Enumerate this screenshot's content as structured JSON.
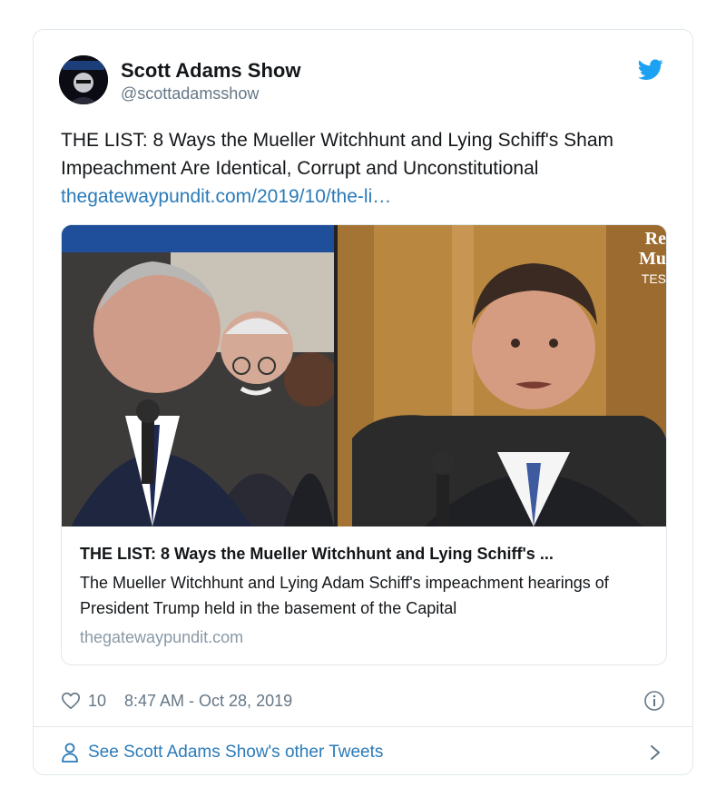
{
  "author": {
    "name": "Scott Adams Show",
    "handle": "@scottadamsshow"
  },
  "tweet": {
    "text": "THE LIST: 8 Ways the Mueller Witchhunt and Lying Schiff's Sham Impeachment Are Identical, Corrupt and Unconstitutional",
    "link": "thegatewaypundit.com/2019/10/the-li…"
  },
  "card": {
    "overlay_text": [
      "Re",
      "Mu",
      "TES"
    ],
    "title": "THE LIST: 8 Ways the Mueller Witchhunt and Lying Schiff's ...",
    "description": "The Mueller Witchhunt and Lying Adam Schiff's impeachment hearings of President Trump held in the basement of the Capital",
    "domain": "thegatewaypundit.com"
  },
  "meta": {
    "like_count": "10",
    "timestamp": "8:47 AM - Oct 28, 2019"
  },
  "footer": {
    "label": "See Scott Adams Show's other Tweets"
  },
  "icons": {
    "brand": "twitter-bird-icon",
    "like": "heart-icon",
    "info": "info-icon",
    "person": "person-icon",
    "chevron": "chevron-right-icon"
  },
  "colors": {
    "brand_blue": "#1da1f2",
    "link_blue": "#2b7bb9",
    "secondary_text": "#657786",
    "border": "#e1e8ed"
  }
}
